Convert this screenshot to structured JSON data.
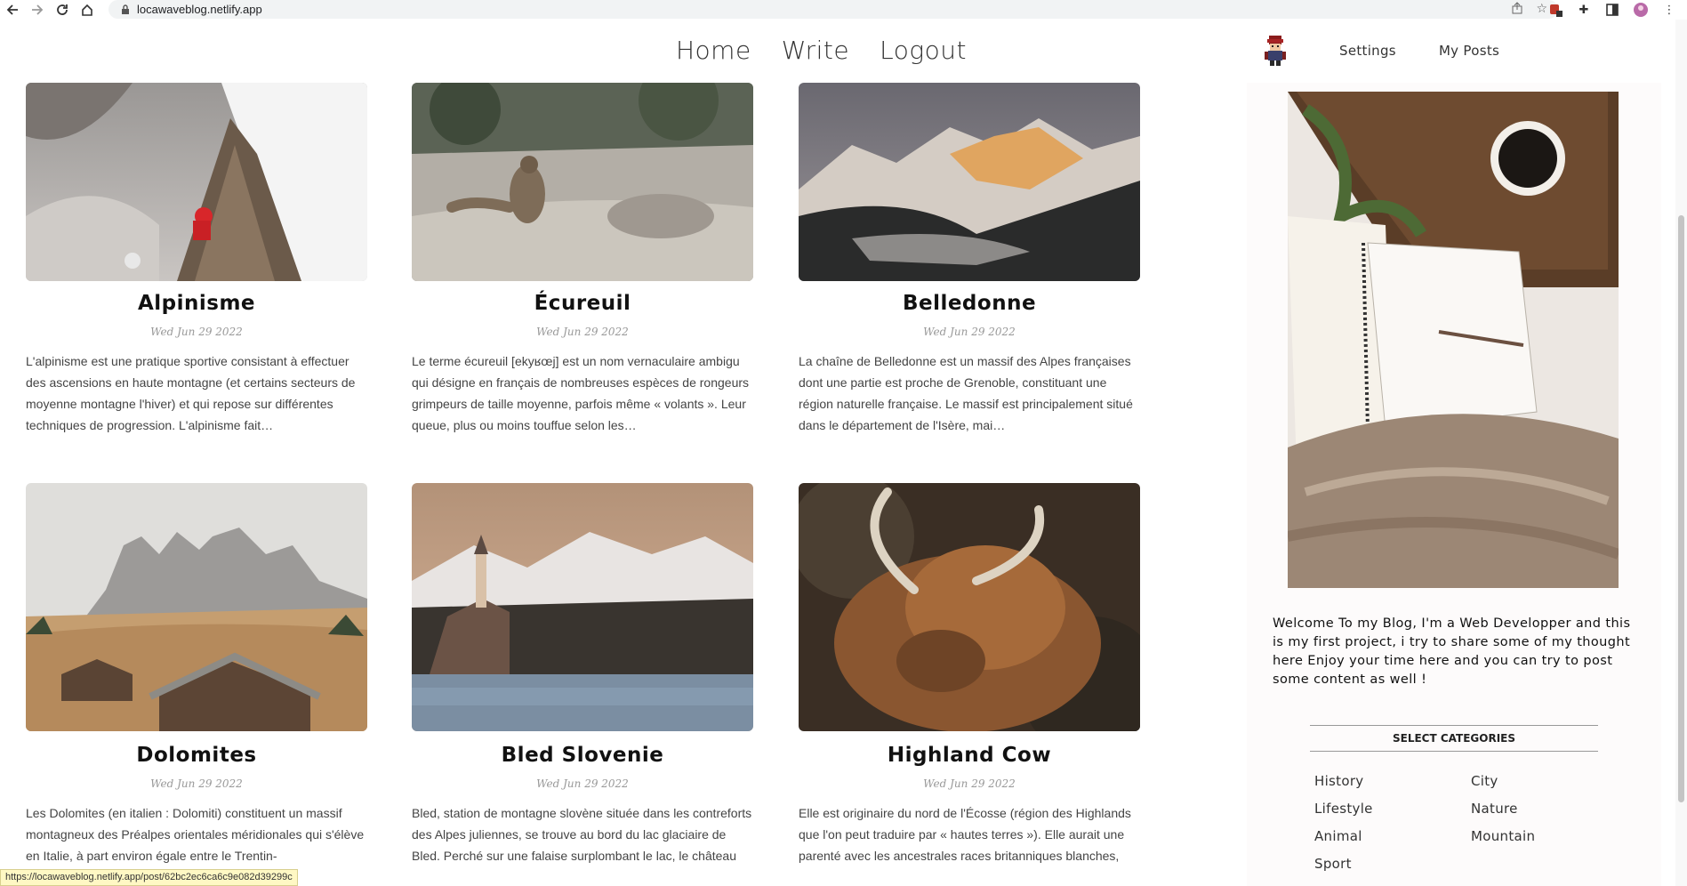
{
  "browser": {
    "url": "locawaveblog.netlify.app",
    "status_url": "https://locawaveblog.netlify.app/post/62bc2ec6ca6c9e082d39299c"
  },
  "nav": {
    "home": "Home",
    "write": "Write",
    "logout": "Logout",
    "settings": "Settings",
    "my_posts": "My Posts"
  },
  "posts": [
    {
      "title": "Alpinisme",
      "date": "Wed Jun 29 2022",
      "desc": "L'alpinisme est une pratique sportive consistant à effectuer des ascensions en haute montagne (et certains secteurs de moyenne montagne l'hiver) et qui repose sur différentes techniques de progression. L'alpinisme fait…"
    },
    {
      "title": "Écureuil",
      "date": "Wed Jun 29 2022",
      "desc": "Le terme écureuil [ekyʁœj] est un nom vernaculaire ambigu qui désigne en français de nombreuses espèces de rongeurs grimpeurs de taille moyenne, parfois même « volants ». Leur queue, plus ou moins touffue selon les…"
    },
    {
      "title": "Belledonne",
      "date": "Wed Jun 29 2022",
      "desc": "La chaîne de Belledonne est un massif des Alpes françaises dont une partie est proche de Grenoble, constituant une région naturelle française. Le massif est principalement situé dans le département de l'Isère, mai…"
    },
    {
      "title": "Dolomites",
      "date": "Wed Jun 29 2022",
      "desc": "Les Dolomites (en italien : Dolomiti) constituent un massif montagneux des Préalpes orientales méridionales qui s'élève en Italie, à part environ égale entre le Trentin-"
    },
    {
      "title": "Bled Slovenie",
      "date": "Wed Jun 29 2022",
      "desc": "Bled, station de montagne slovène située dans les contreforts des Alpes juliennes, se trouve au bord du lac glaciaire de Bled. Perché sur une falaise surplombant le lac, le château de Bled datant du XIe siècle abrite un"
    },
    {
      "title": "Highland Cow",
      "date": "Wed Jun 29 2022",
      "desc": "Elle est originaire du nord de l'Écosse (région des Highlands que l'on peut traduire par « hautes terres »). Elle aurait une parenté avec les ancestrales races britanniques blanches, comme la chillingham ou la whit"
    }
  ],
  "sidebar": {
    "about": "Welcome To my Blog, I'm a Web Developper and this is my first project, i try to share some of my thought here Enjoy your time here and you can try to post some content as well !",
    "categories_title": "SELECT CATEGORIES",
    "categories": [
      "History",
      "City",
      "Lifestyle",
      "Nature",
      "Animal",
      "Mountain",
      "Sport"
    ]
  },
  "icons": {
    "back": "arrow-left-icon",
    "forward": "arrow-right-icon",
    "reload": "reload-icon",
    "home": "home-icon",
    "lock": "lock-icon",
    "share": "share-icon",
    "star": "star-icon",
    "extension": "puzzle-icon",
    "sidepanel": "sidepanel-icon",
    "menu": "kebab-menu-icon"
  }
}
